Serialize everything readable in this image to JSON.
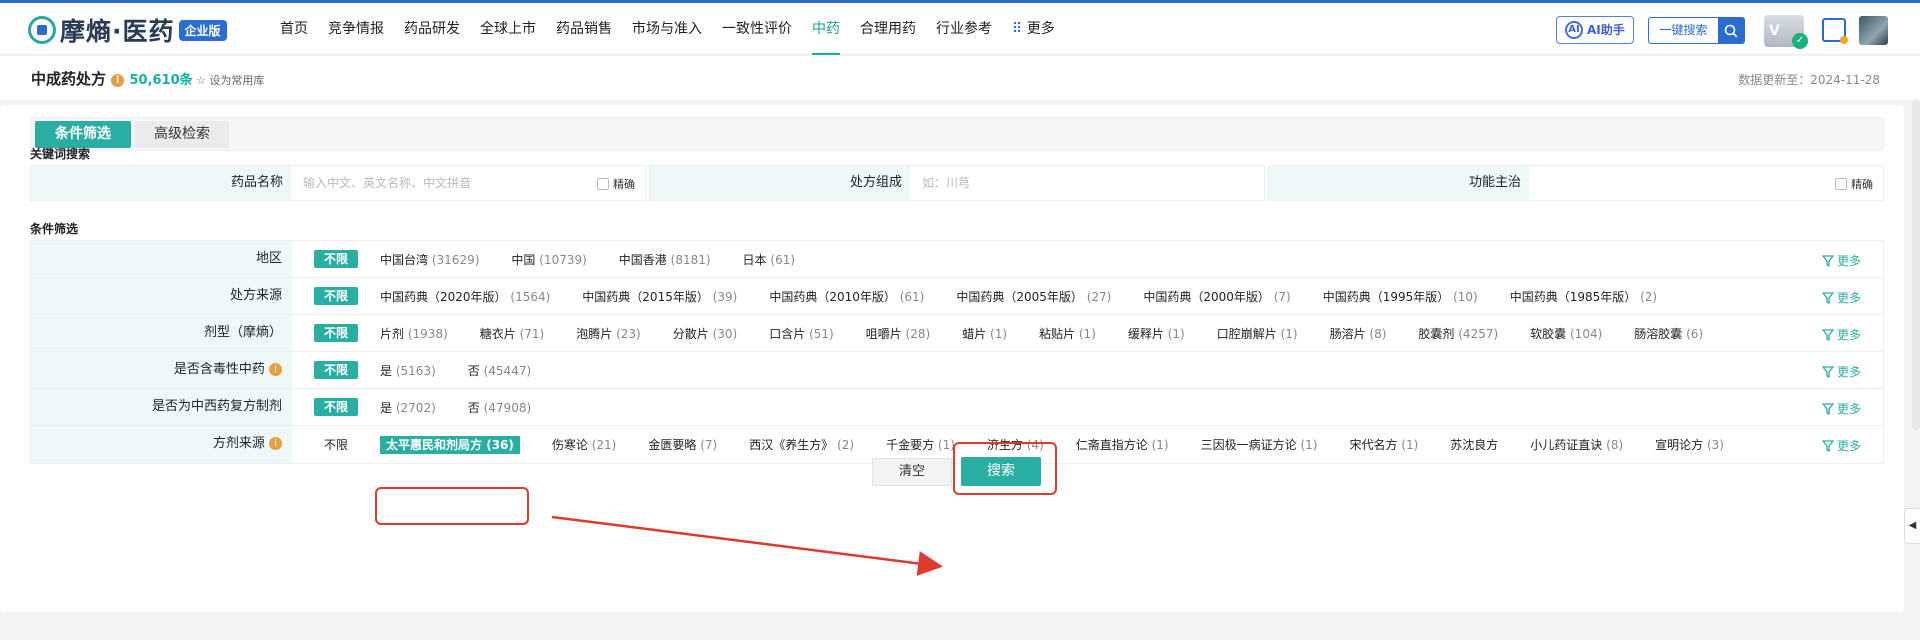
{
  "brand": {
    "name": "摩熵·医药",
    "badge": "企业版"
  },
  "nav": [
    "首页",
    "竞争情报",
    "药品研发",
    "全球上市",
    "药品销售",
    "市场与准入",
    "一致性评价",
    "中药",
    "合理用药",
    "行业参考",
    "更多"
  ],
  "nav_active": "中药",
  "header": {
    "ai_label": "AI助手",
    "ai_glyph": "AI",
    "quick_search": "一键搜索",
    "vip_label": "V"
  },
  "page": {
    "title": "中成药处方",
    "count": "50,610条",
    "favorite": "设为常用库",
    "updated": "数据更新至：2024-11-28"
  },
  "tabs": [
    "条件筛选",
    "高级检索"
  ],
  "keyword_section": "关键词搜索",
  "keyword_fields": [
    {
      "label": "药品名称",
      "placeholder": "输入中文、英文名称、中文拼音",
      "exact": "精确"
    },
    {
      "label": "处方组成",
      "placeholder": "如：川芎",
      "exact": ""
    },
    {
      "label": "功能主治",
      "placeholder": "",
      "exact": "精确"
    }
  ],
  "filter_section": "条件筛选",
  "unlimited": "不限",
  "more_label": "更多",
  "filters": [
    {
      "label": "地区",
      "info": false,
      "options": [
        [
          "中国台湾",
          "(31629)"
        ],
        [
          "中国",
          "(10739)"
        ],
        [
          "中国香港",
          "(8181)"
        ],
        [
          "日本",
          "(61)"
        ]
      ]
    },
    {
      "label": "处方来源",
      "info": false,
      "options": [
        [
          "中国药典（2020年版）",
          "(1564)"
        ],
        [
          "中国药典（2015年版）",
          "(39)"
        ],
        [
          "中国药典（2010年版）",
          "(61)"
        ],
        [
          "中国药典（2005年版）",
          "(27)"
        ],
        [
          "中国药典（2000年版）",
          "(7)"
        ],
        [
          "中国药典（1995年版）",
          "(10)"
        ],
        [
          "中国药典（1985年版）",
          "(2)"
        ]
      ]
    },
    {
      "label": "剂型（摩熵）",
      "info": false,
      "options": [
        [
          "片剂",
          "(1938)"
        ],
        [
          "糖衣片",
          "(71)"
        ],
        [
          "泡腾片",
          "(23)"
        ],
        [
          "分散片",
          "(30)"
        ],
        [
          "口含片",
          "(51)"
        ],
        [
          "咀嚼片",
          "(28)"
        ],
        [
          "蜡片",
          "(1)"
        ],
        [
          "粘贴片",
          "(1)"
        ],
        [
          "缓释片",
          "(1)"
        ],
        [
          "口腔崩解片",
          "(1)"
        ],
        [
          "肠溶片",
          "(8)"
        ],
        [
          "胶囊剂",
          "(4257)"
        ],
        [
          "软胶囊",
          "(104)"
        ],
        [
          "肠溶胶囊",
          "(6)"
        ]
      ]
    },
    {
      "label": "是否含毒性中药",
      "info": true,
      "options": [
        [
          "是",
          "(5163)"
        ],
        [
          "否",
          "(45447)"
        ]
      ]
    },
    {
      "label": "是否为中西药复方制剂",
      "info": false,
      "options": [
        [
          "是",
          "(2702)"
        ],
        [
          "否",
          "(47908)"
        ]
      ]
    },
    {
      "label": "方剂来源",
      "info": true,
      "unlimited_selected": false,
      "selected_index": 0,
      "options": [
        [
          "太平惠民和剂局方",
          "(36)"
        ],
        [
          "伤寒论",
          "(21)"
        ],
        [
          "金匮要略",
          "(7)"
        ],
        [
          "西汉《养生方》",
          "(2)"
        ],
        [
          "千金要方",
          "(1)"
        ],
        [
          "济生方",
          "(4)"
        ],
        [
          "仁斋直指方论",
          "(1)"
        ],
        [
          "三因极一病证方论",
          "(1)"
        ],
        [
          "宋代名方",
          "(1)"
        ],
        [
          "苏沈良方",
          ""
        ],
        [
          "小儿药证直诀",
          "(8)"
        ],
        [
          "宣明论方",
          "(3)"
        ]
      ]
    }
  ],
  "actions": {
    "clear": "清空",
    "search": "搜索"
  },
  "side_tab": "◀",
  "colors": {
    "accent": "#2aaea3",
    "brand_blue": "#2a6ccf",
    "annotation_red": "#e03a2e"
  }
}
